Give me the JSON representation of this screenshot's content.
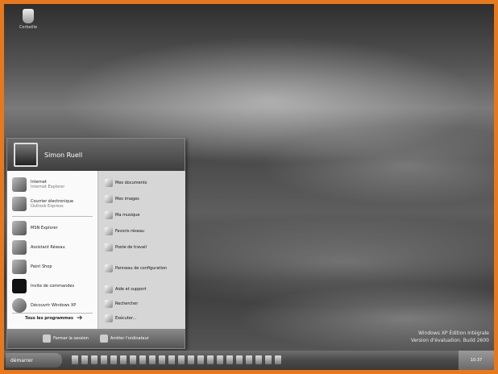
{
  "desktop": {
    "icon_label": "Corbeille",
    "watermark_line1": "Windows XP Édition Intégrale",
    "watermark_line2": "Version d'évaluation. Build 2600"
  },
  "start_menu": {
    "user_name": "Simon Ruell",
    "left_items": [
      {
        "label": "Internet",
        "sub": "Internet Explorer",
        "icon": "ie-icon"
      },
      {
        "label": "Courrier électronique",
        "sub": "Outlook Express",
        "icon": "mail-icon"
      },
      {
        "label": "MSN Explorer",
        "sub": "",
        "icon": "msn-icon"
      },
      {
        "label": "Assistant Réseau",
        "sub": "",
        "icon": "network-icon"
      },
      {
        "label": "Paint Shop",
        "sub": "",
        "icon": "paint-icon"
      },
      {
        "label": "Invite de commandes",
        "sub": "",
        "icon": "cmd-icon"
      },
      {
        "label": "Découvrir Windows XP",
        "sub": "",
        "icon": "tour-icon"
      }
    ],
    "all_programs": "Tous les programmes",
    "right_items": [
      {
        "label": "Mes documents",
        "icon": "folder-icon"
      },
      {
        "label": "Mes images",
        "icon": "folder-icon"
      },
      {
        "label": "Ma musique",
        "icon": "folder-icon"
      },
      {
        "label": "Favoris réseau",
        "icon": "network-places-icon"
      },
      {
        "label": "Poste de travail",
        "icon": "computer-icon"
      },
      {
        "label": "Panneau de configuration",
        "icon": "control-panel-icon"
      },
      {
        "label": "Aide et support",
        "icon": "help-icon"
      },
      {
        "label": "Rechercher",
        "icon": "search-icon"
      },
      {
        "label": "Exécuter...",
        "icon": "run-icon"
      }
    ],
    "footer": {
      "logoff": "Fermer la session",
      "shutdown": "Arrêter l'ordinateur"
    }
  },
  "taskbar": {
    "start_label": "démarrer",
    "clock": "10:37"
  }
}
